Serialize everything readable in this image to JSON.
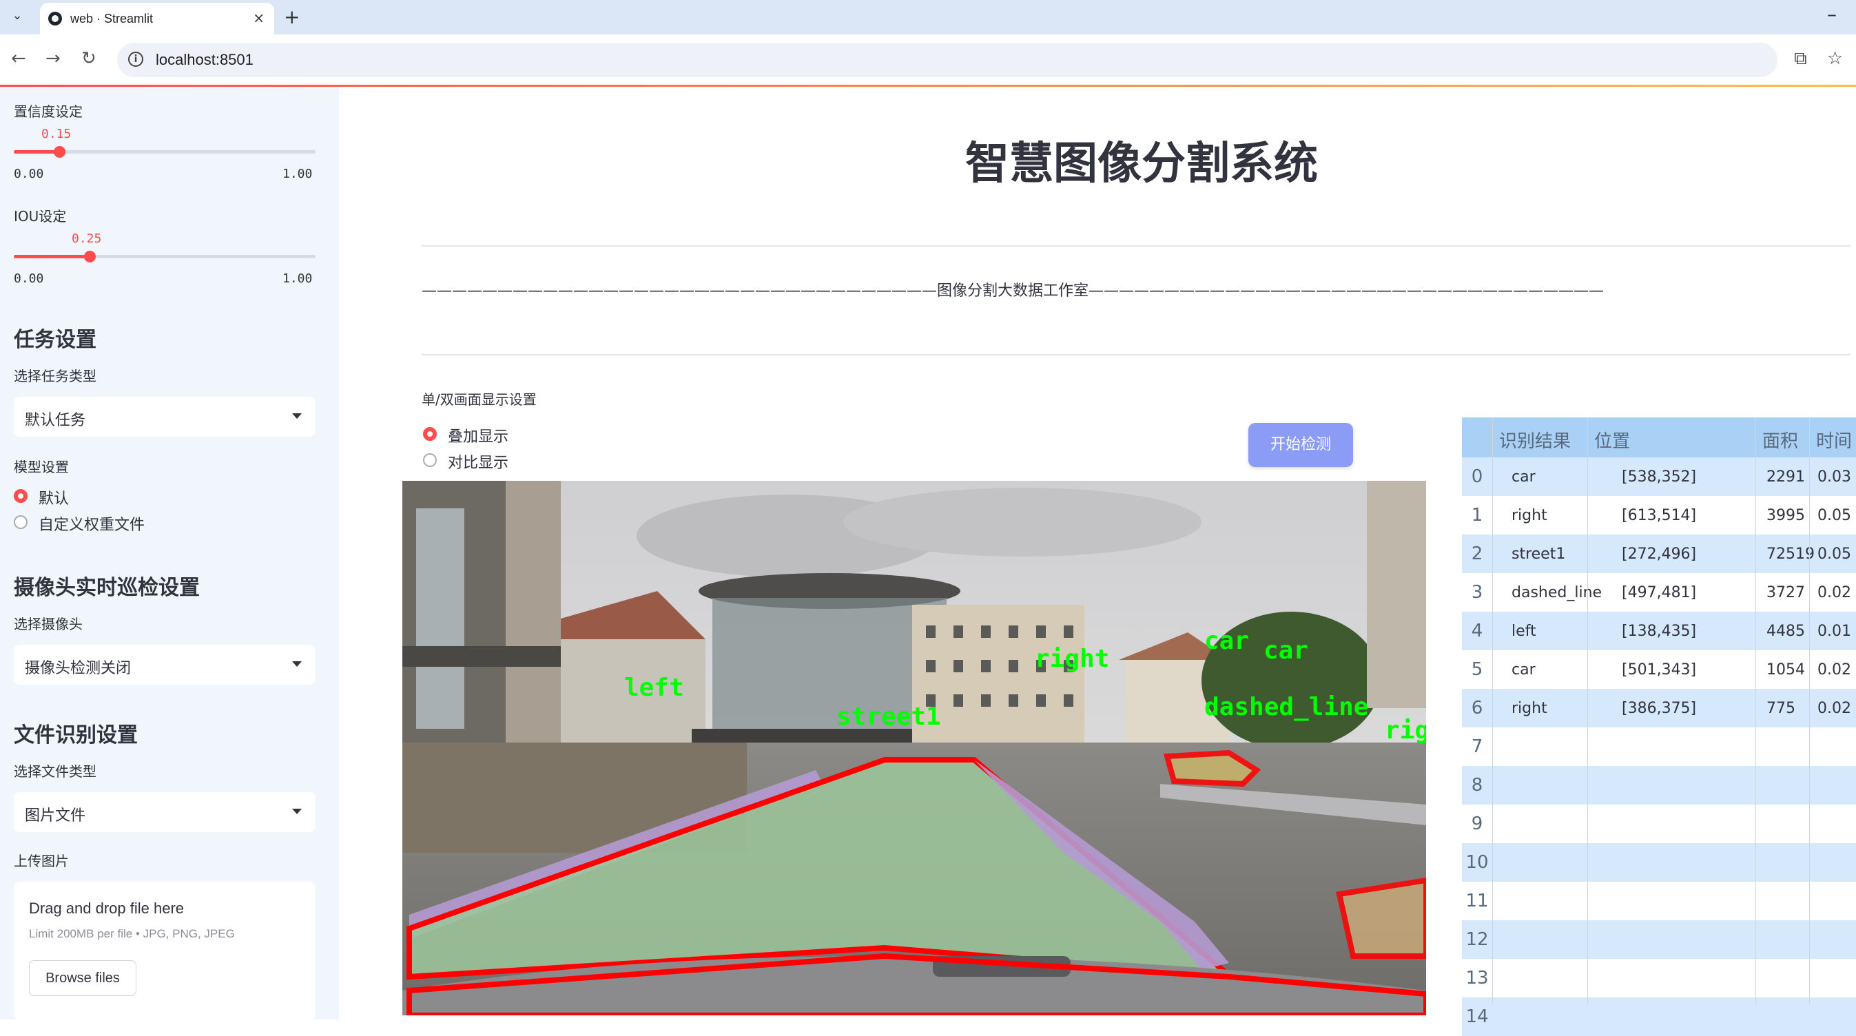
{
  "browser": {
    "tab_title": "web · Streamlit",
    "url": "localhost:8501",
    "new_tab": "+",
    "close": "×",
    "minimize": "–"
  },
  "sidebar": {
    "confidence": {
      "label": "置信度设定",
      "value": "0.15",
      "fraction": 0.15,
      "min": "0.00",
      "max": "1.00"
    },
    "iou": {
      "label": "IOU设定",
      "value": "0.25",
      "fraction": 0.25,
      "min": "0.00",
      "max": "1.00"
    },
    "task_section": "任务设置",
    "task_type_label": "选择任务类型",
    "task_type_value": "默认任务",
    "model_label": "模型设置",
    "model_options": [
      "默认",
      "自定义权重文件"
    ],
    "camera_section": "摄像头实时巡检设置",
    "camera_label": "选择摄像头",
    "camera_value": "摄像头检测关闭",
    "file_section": "文件识别设置",
    "file_type_label": "选择文件类型",
    "file_type_value": "图片文件",
    "upload_label": "上传图片",
    "uploader": {
      "title": "Drag and drop file here",
      "subtitle": "Limit 200MB per file • JPG, PNG, JPEG",
      "button": "Browse files"
    }
  },
  "main": {
    "title": "智慧图像分割系统",
    "studio_line": "——————————————————————————————————图像分割大数据工作室——————————————————————————————————",
    "display_mode_label": "单/双画面显示设置",
    "display_options": [
      "叠加显示",
      "对比显示"
    ],
    "start_button": "开始检测",
    "overlay_labels": [
      "left",
      "street1",
      "right",
      "car",
      "car",
      "dashed_line",
      "rig"
    ]
  },
  "table": {
    "headers": [
      "识别结果",
      "位置",
      "面积",
      "时间"
    ],
    "rows": [
      {
        "idx": "0",
        "label": "car",
        "pos": "[538,352]",
        "area": "2291",
        "time": "0.03"
      },
      {
        "idx": "1",
        "label": "right",
        "pos": "[613,514]",
        "area": "3995",
        "time": "0.05"
      },
      {
        "idx": "2",
        "label": "street1",
        "pos": "[272,496]",
        "area": "72519",
        "time": "0.05"
      },
      {
        "idx": "3",
        "label": "dashed_line",
        "pos": "[497,481]",
        "area": "3727",
        "time": "0.02"
      },
      {
        "idx": "4",
        "label": "left",
        "pos": "[138,435]",
        "area": "4485",
        "time": "0.01"
      },
      {
        "idx": "5",
        "label": "car",
        "pos": "[501,343]",
        "area": "1054",
        "time": "0.02"
      },
      {
        "idx": "6",
        "label": "right",
        "pos": "[386,375]",
        "area": "775",
        "time": "0.02"
      },
      {
        "idx": "7"
      },
      {
        "idx": "8"
      },
      {
        "idx": "9"
      },
      {
        "idx": "10"
      },
      {
        "idx": "11"
      },
      {
        "idx": "12"
      },
      {
        "idx": "13"
      },
      {
        "idx": "14"
      }
    ]
  },
  "colors": {
    "accent": "#ff4b4b",
    "button": "#8a9cf5",
    "table_header": "#a9d0f5",
    "table_stripe": "#d6e8fb"
  }
}
